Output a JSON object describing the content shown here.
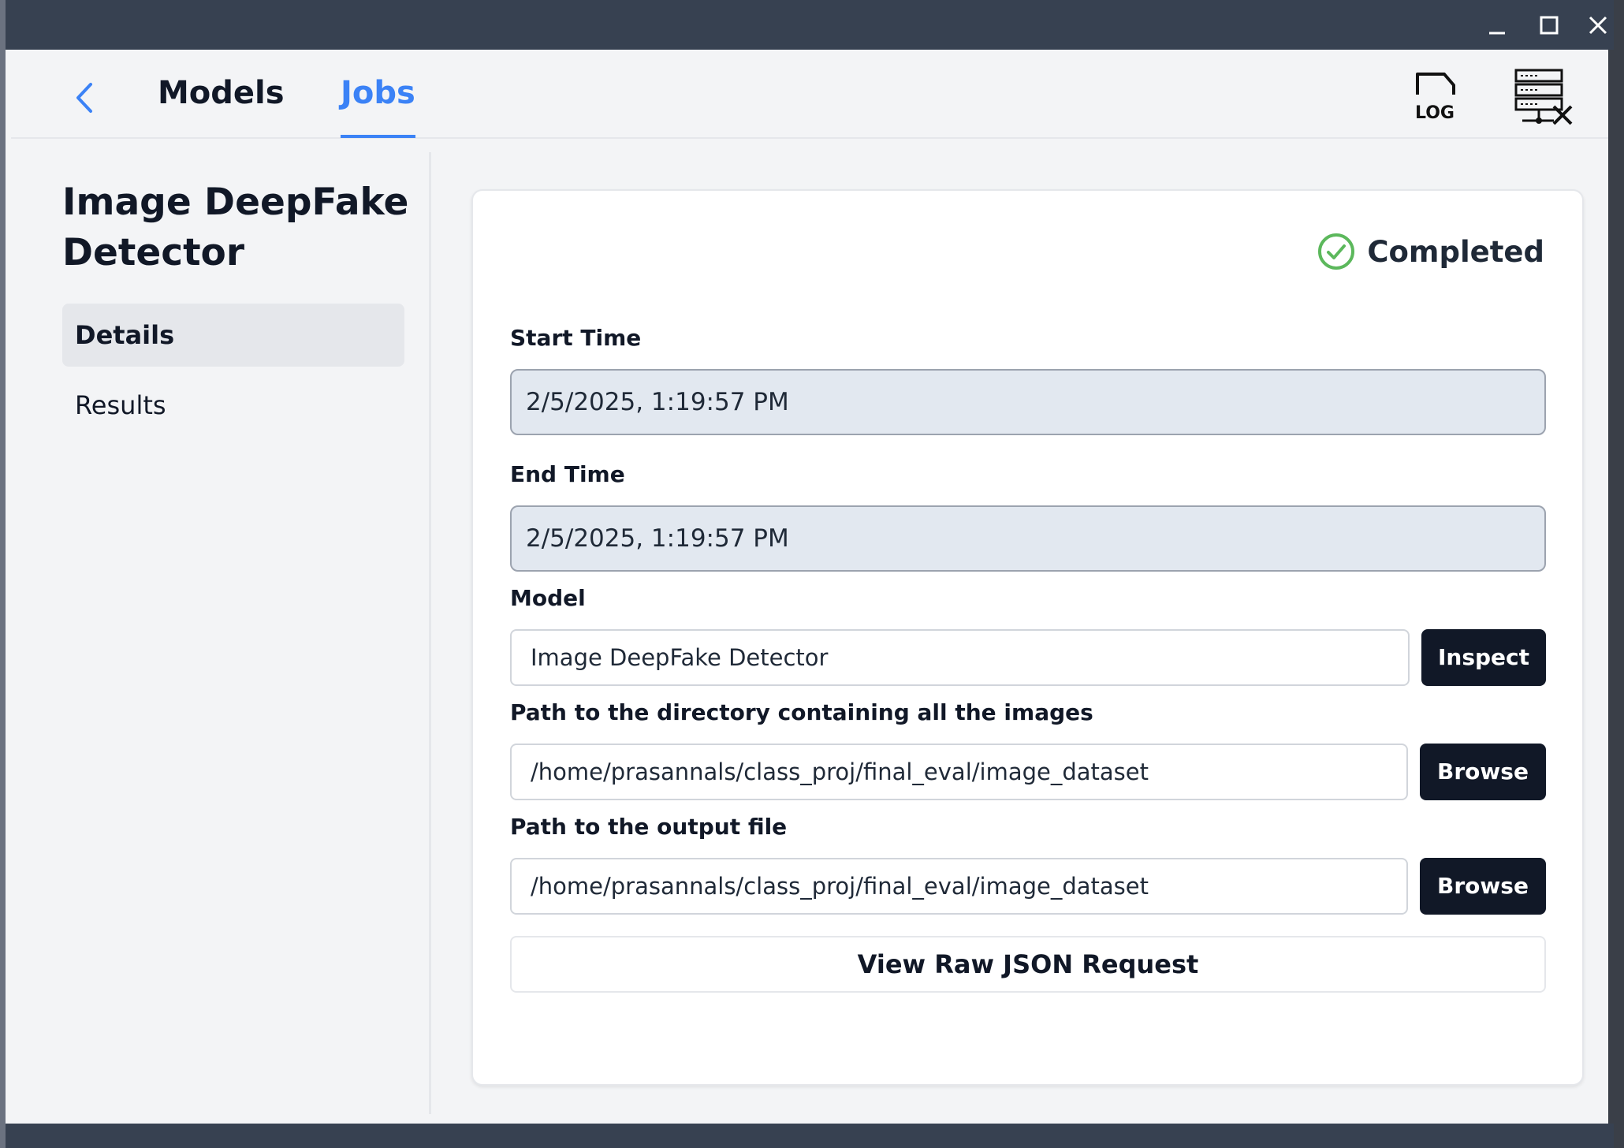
{
  "nav": {
    "tabs": [
      {
        "label": "Models"
      },
      {
        "label": "Jobs"
      }
    ],
    "log_label": "LOG"
  },
  "sidebar": {
    "title": "Image DeepFake Detector",
    "items": [
      {
        "label": "Details"
      },
      {
        "label": "Results"
      }
    ]
  },
  "job": {
    "status": "Completed",
    "start_time_label": "Start Time",
    "start_time_value": "2/5/2025, 1:19:57 PM",
    "end_time_label": "End Time",
    "end_time_value": "2/5/2025, 1:19:57 PM",
    "model_label": "Model",
    "model_value": "Image DeepFake Detector",
    "inspect_label": "Inspect",
    "input_dir_label": "Path to the directory containing all the images",
    "input_dir_value": "/home/prasannals/class_proj/final_eval/image_dataset",
    "output_file_label": "Path to the output file",
    "output_file_value": "/home/prasannals/class_proj/final_eval/image_dataset",
    "browse_label": "Browse",
    "json_button_label": "View Raw JSON Request"
  },
  "colors": {
    "accent": "#3b82f6",
    "success": "#5cb85c",
    "titlebar": "#374151",
    "dark_button": "#111827"
  }
}
